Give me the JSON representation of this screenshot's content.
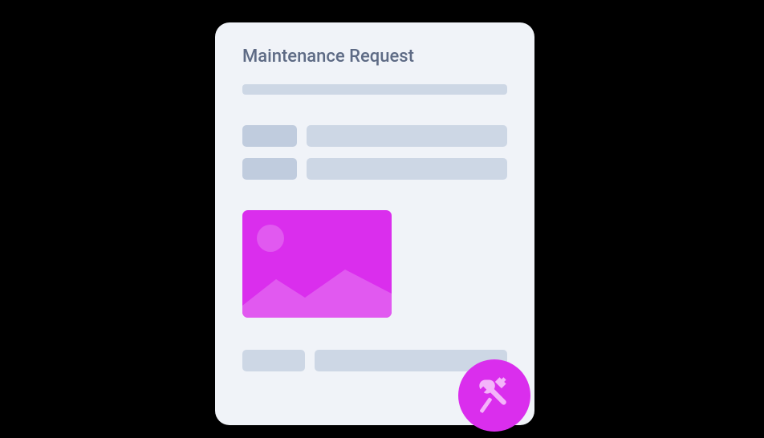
{
  "card": {
    "title": "Maintenance Request"
  },
  "colors": {
    "accent": "#da2eed",
    "accent_light": "#e159f0",
    "card_bg": "#f0f3f8",
    "placeholder_dark": "#c0ccde",
    "placeholder_light": "#cdd7e5",
    "title_text": "#5e6b85"
  },
  "icons": {
    "image_placeholder": "image-placeholder-icon",
    "tools": "tools-icon"
  }
}
